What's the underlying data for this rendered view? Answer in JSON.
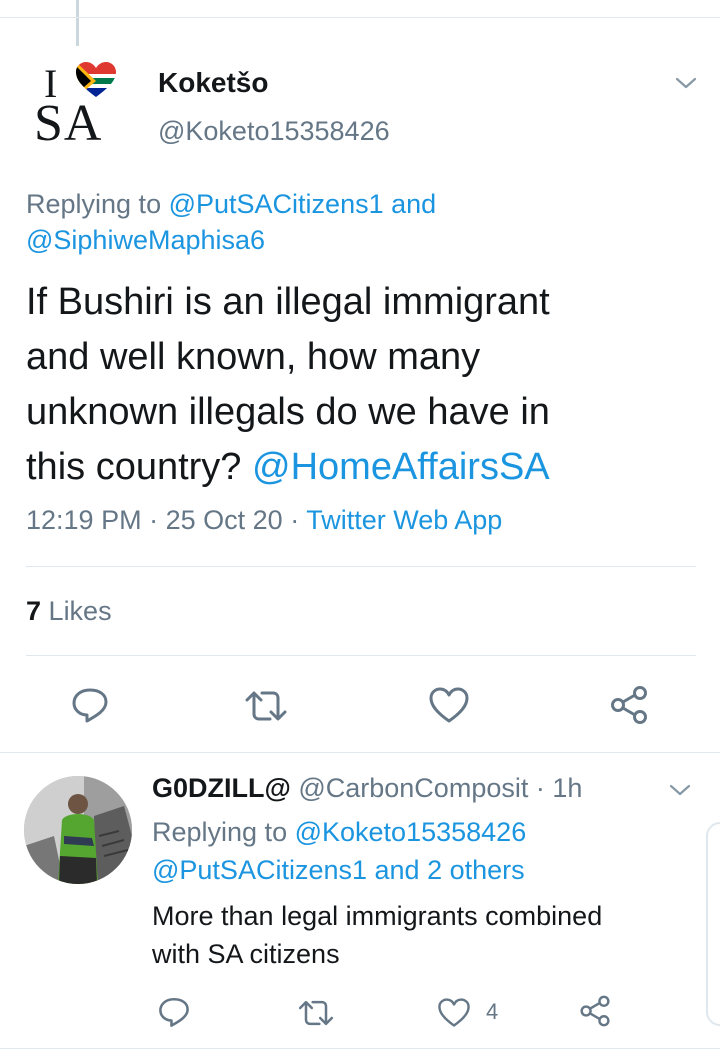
{
  "tweet": {
    "author_name": "Koketšo",
    "author_handle": "@Koketo15358426",
    "replying_prefix": "Replying to",
    "replying_user1": "@PutSACitizens1",
    "replying_and": "and",
    "replying_user2": "@SiphiweMaphisa6",
    "text_line1": "If Bushiri is an illegal immigrant",
    "text_line2": "and well known, how many",
    "text_line3": "unknown illegals do we have in",
    "text_line4": "this country?",
    "text_mention": "@HomeAffairsSA",
    "time": "12:19 PM",
    "date": "25 Oct 20",
    "separator": "·",
    "source": "Twitter Web App",
    "likes_count": "7",
    "likes_label": "Likes",
    "avatar_logo_i": "I",
    "avatar_logo_sa": "SA"
  },
  "reply": {
    "author_name": "G0DZILL@",
    "author_handle": "@CarbonComposit",
    "separator": "·",
    "age": "1h",
    "replying_prefix": "Replying to",
    "replying_user1": "@Koketo15358426",
    "replying_user2": "@PutSACitizens1",
    "replying_others": "and 2 others",
    "text_line1": "More than legal immigrants combined",
    "text_line2": "with SA citizens",
    "like_count": "4"
  },
  "icons": {
    "reply": "comment-icon",
    "retweet": "retweet-icon",
    "like": "heart-icon",
    "share": "share-icon",
    "more": "chevron-down-icon"
  },
  "colors": {
    "link": "#1b95e0",
    "secondary_text": "#657786",
    "primary_text": "#14171a",
    "divider": "#e1e8ed"
  }
}
